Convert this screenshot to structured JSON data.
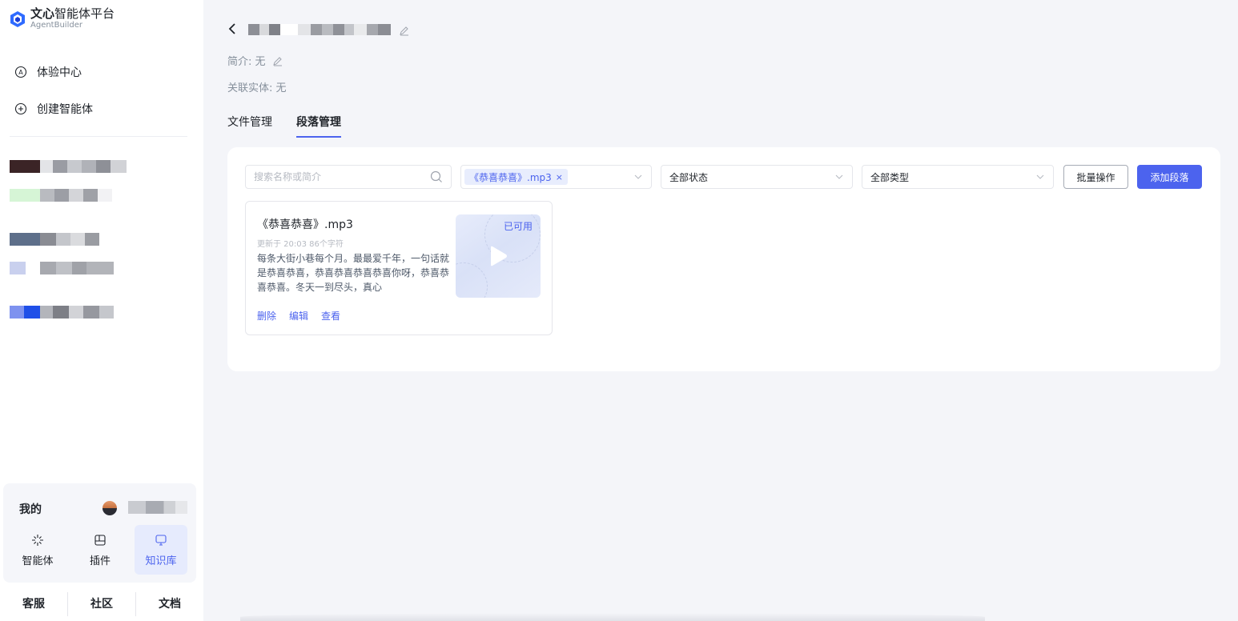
{
  "app": {
    "logo_bold": "文心",
    "logo_rest": "智能体平台",
    "logo_sub": "AgentBuilder"
  },
  "nav": {
    "experience": "体验中心",
    "create": "创建智能体"
  },
  "mine": {
    "title": "我的",
    "tabs": [
      {
        "label": "智能体",
        "icon": "sparkle-icon"
      },
      {
        "label": "插件",
        "icon": "plugin-icon"
      },
      {
        "label": "知识库",
        "icon": "monitor-icon"
      }
    ]
  },
  "footer": {
    "links": [
      "客服",
      "社区",
      "文档"
    ]
  },
  "detail": {
    "intro_label": "简介: 无",
    "entity_label": "关联实体: 无"
  },
  "tabs": [
    "文件管理",
    "段落管理"
  ],
  "toolbar": {
    "search_placeholder": "搜索名称或简介",
    "file_tag": "《恭喜恭喜》.mp3",
    "tag_close": "×",
    "status_select": "全部状态",
    "type_select": "全部类型",
    "batch_button": "批量操作",
    "add_button": "添加段落"
  },
  "card": {
    "title": "《恭喜恭喜》.mp3",
    "meta": "更新于 20:03  86个字符",
    "description": "每条大街小巷每个月。最最爱千年，一句话就是恭喜恭喜，恭喜恭喜恭喜恭喜你呀，恭喜恭喜恭喜。冬天一到尽头，真心",
    "status": "已可用",
    "actions": [
      "删除",
      "编辑",
      "查看"
    ]
  },
  "colors": {
    "accent": "#4c63ee",
    "background": "#f4f5f9"
  }
}
